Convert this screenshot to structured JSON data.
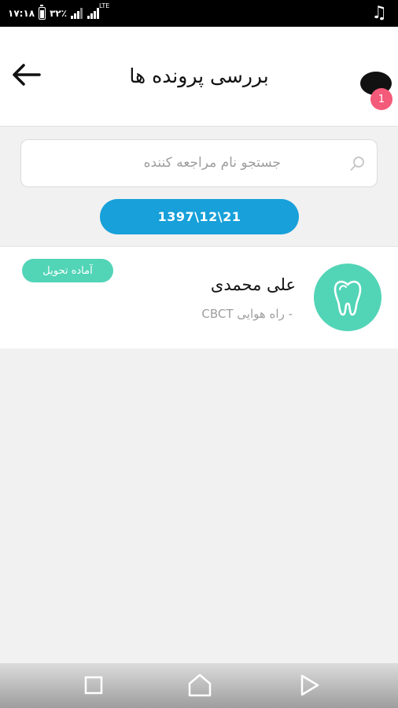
{
  "status_bar": {
    "time": "۱۷:۱۸",
    "battery": "۳۲٪",
    "network": "LTE",
    "battery_level": 0.32
  },
  "header": {
    "title": "بررسی پرونده ها",
    "notification_count": "1",
    "back_icon": "arrow-left-icon",
    "chat_icon": "chat-bubble-icon"
  },
  "search": {
    "placeholder": "جستجو نام مراجعه کننده",
    "icon": "search-icon"
  },
  "date_filter": {
    "label": "1397\\12\\21"
  },
  "records": [
    {
      "name": "علی محمدی",
      "service": "- راه هوایی CBCT",
      "status": "آماده تحویل",
      "icon": "tooth-icon"
    }
  ],
  "nav_bar": {
    "buttons": [
      "recents-square-icon",
      "home-icon",
      "back-triangle-icon"
    ]
  },
  "colors": {
    "accent_blue": "#17a0d9",
    "teal": "#52d4b7",
    "badge_pink": "#f45a7a",
    "background": "#f1f1f1"
  }
}
